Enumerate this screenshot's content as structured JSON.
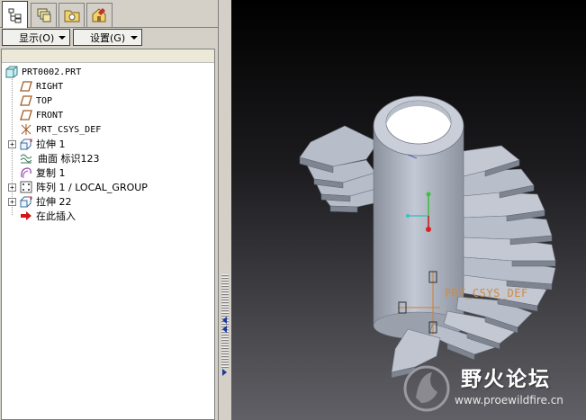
{
  "tabs": [
    {
      "name": "model-tree-tab",
      "icon": "model-tree-icon",
      "active": true
    },
    {
      "name": "layers-tab",
      "icon": "layers-icon",
      "active": false
    },
    {
      "name": "folder-browser-tab",
      "icon": "folder-icon",
      "active": false
    },
    {
      "name": "favorites-tab",
      "icon": "favorites-icon",
      "active": false
    }
  ],
  "toolbar": {
    "show_label": "显示(O)",
    "settings_label": "设置(G)"
  },
  "tree": {
    "root": "PRT0002.PRT",
    "items": [
      {
        "label": "RIGHT",
        "icon": "datum-plane-icon",
        "expandable": false
      },
      {
        "label": "TOP",
        "icon": "datum-plane-icon",
        "expandable": false
      },
      {
        "label": "FRONT",
        "icon": "datum-plane-icon",
        "expandable": false
      },
      {
        "label": "PRT_CSYS_DEF",
        "icon": "coordinate-system-icon",
        "expandable": false
      },
      {
        "label": "拉伸 1",
        "icon": "extrude-icon",
        "expandable": true
      },
      {
        "label": "曲面 标识123",
        "icon": "surface-icon",
        "expandable": false
      },
      {
        "label": "复制 1",
        "icon": "copy-icon",
        "expandable": false
      },
      {
        "label": "阵列 1 / LOCAL_GROUP",
        "icon": "pattern-icon",
        "expandable": true
      },
      {
        "label": "拉伸 22",
        "icon": "extrude-icon",
        "expandable": true
      },
      {
        "label": "在此插入",
        "icon": "insert-here-arrow-icon",
        "expandable": false
      }
    ]
  },
  "viewport": {
    "csys_label": "PRT_CSYS_DEF",
    "watermark_title": "野火论坛",
    "watermark_url": "www.proewildfire.cn"
  },
  "colors": {
    "panel_bg": "#d4d0c8",
    "model_face": "#b4bac6",
    "model_shadow": "#7d8390",
    "csys_label": "#d08a40"
  }
}
